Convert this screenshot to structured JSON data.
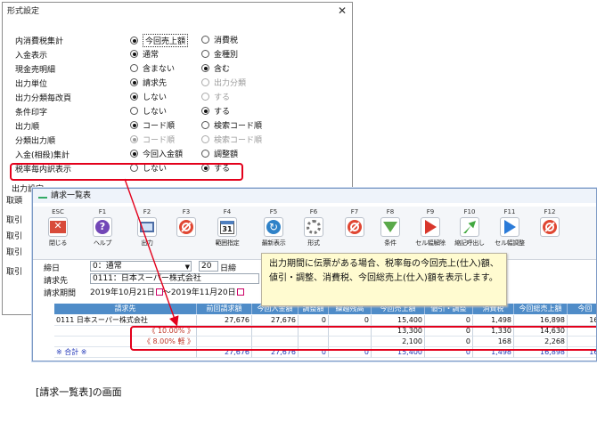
{
  "dialog": {
    "title": "形式設定",
    "close": "✕",
    "options": [
      {
        "label": "内消費税集計",
        "a": "今回売上額",
        "b": "消費税",
        "sel": "a",
        "a_dis": false,
        "b_dis": false
      },
      {
        "label": "入金表示",
        "a": "通常",
        "b": "金種別",
        "sel": "a",
        "a_dis": false,
        "b_dis": false
      },
      {
        "label": "現金売明細",
        "a": "含まない",
        "b": "含む",
        "sel": "b",
        "a_dis": false,
        "b_dis": false
      },
      {
        "label": "出力単位",
        "a": "請求先",
        "b": "出力分類",
        "sel": "a",
        "a_dis": false,
        "b_dis": true
      },
      {
        "label": "出力分類毎改頁",
        "a": "しない",
        "b": "する",
        "sel": "a",
        "a_dis": false,
        "b_dis": true
      },
      {
        "label": "条件印字",
        "a": "しない",
        "b": "する",
        "sel": "b",
        "a_dis": false,
        "b_dis": false
      },
      {
        "label": "出力順",
        "a": "コード順",
        "b": "検索コード順",
        "sel": "a",
        "a_dis": false,
        "b_dis": false
      },
      {
        "label": "分類出力順",
        "a": "コード順",
        "b": "検索コード順",
        "sel": "a",
        "a_dis": true,
        "b_dis": true
      },
      {
        "label": "入金(相殺)集計",
        "a": "今回入金額",
        "b": "調整額",
        "sel": "a",
        "a_dis": false,
        "b_dis": false
      },
      {
        "label": "税率毎内訳表示",
        "a": "しない",
        "b": "する",
        "sel": "b",
        "a_dis": false,
        "b_dis": false
      }
    ],
    "output_settings": "出力設定",
    "cut_labels": [
      "取頭",
      "取引",
      "取引",
      "取引",
      "取引"
    ]
  },
  "window": {
    "title": "請求一覧表",
    "toolbar": [
      {
        "key": "ESC",
        "label": "閉じる",
        "icon": "close-icon"
      },
      {
        "key": "F1",
        "label": "ヘルプ",
        "icon": "help-icon"
      },
      {
        "key": "F2",
        "label": "出力",
        "icon": "output-icon"
      },
      {
        "key": "F3",
        "label": "",
        "icon": "disabled-icon"
      },
      {
        "key": "F4",
        "label": "範囲指定",
        "icon": "calendar-icon"
      },
      {
        "key": "F5",
        "label": "最新表示",
        "icon": "refresh-icon"
      },
      {
        "key": "F6",
        "label": "形式",
        "icon": "gear-icon"
      },
      {
        "key": "F7",
        "label": "",
        "icon": "disabled-icon"
      },
      {
        "key": "F8",
        "label": "条件",
        "icon": "filter-icon"
      },
      {
        "key": "F9",
        "label": "セル幅解除",
        "icon": "cell-width-release-icon"
      },
      {
        "key": "F10",
        "label": "縮記呼出し",
        "icon": "recall-icon"
      },
      {
        "key": "F11",
        "label": "セル幅調整",
        "icon": "cell-width-adjust-icon"
      },
      {
        "key": "F12",
        "label": "",
        "icon": "disabled-icon"
      }
    ],
    "form": {
      "closing_label": "締日",
      "closing_value": "0：通常",
      "closing_day": "20",
      "closing_suffix": "日締",
      "billing_label": "請求先",
      "billing_value": "0111：日本スーパー株式会社",
      "period_label": "請求期間",
      "period_value": "2019年10月21日",
      "period_sep": "～",
      "period_end": "2019年11月20日"
    },
    "callout": "出力期間に伝票がある場合、税率毎の今回売上(仕入)額、値引・調整、消費税、今回総売上(仕入)額を表示します。",
    "grid": {
      "headers": [
        "請求先",
        "前回請求額",
        "今回入金額",
        "調整額",
        "繰越残高",
        "今回売上額",
        "値引・調整",
        "消費税",
        "今回総売上額",
        "今回"
      ],
      "rows": [
        {
          "cells": [
            "0111  日本スーパー株式会社",
            "27,676",
            "27,676",
            "0",
            "0",
            "15,400",
            "0",
            "1,498",
            "16,898",
            "16,"
          ],
          "kind": "main"
        },
        {
          "cells": [
            "《 10.00% 》",
            "",
            "",
            "",
            "",
            "13,300",
            "0",
            "1,330",
            "14,630",
            ""
          ],
          "kind": "tax"
        },
        {
          "cells": [
            "《 8.00% 軽 》",
            "",
            "",
            "",
            "",
            "2,100",
            "0",
            "168",
            "2,268",
            ""
          ],
          "kind": "tax"
        },
        {
          "cells": [
            "※ 合計 ※",
            "27,676",
            "27,676",
            "0",
            "0",
            "15,400",
            "0",
            "1,498",
            "16,898",
            "16,"
          ],
          "kind": "total"
        }
      ]
    }
  },
  "caption": "[請求一覧表]の画面"
}
